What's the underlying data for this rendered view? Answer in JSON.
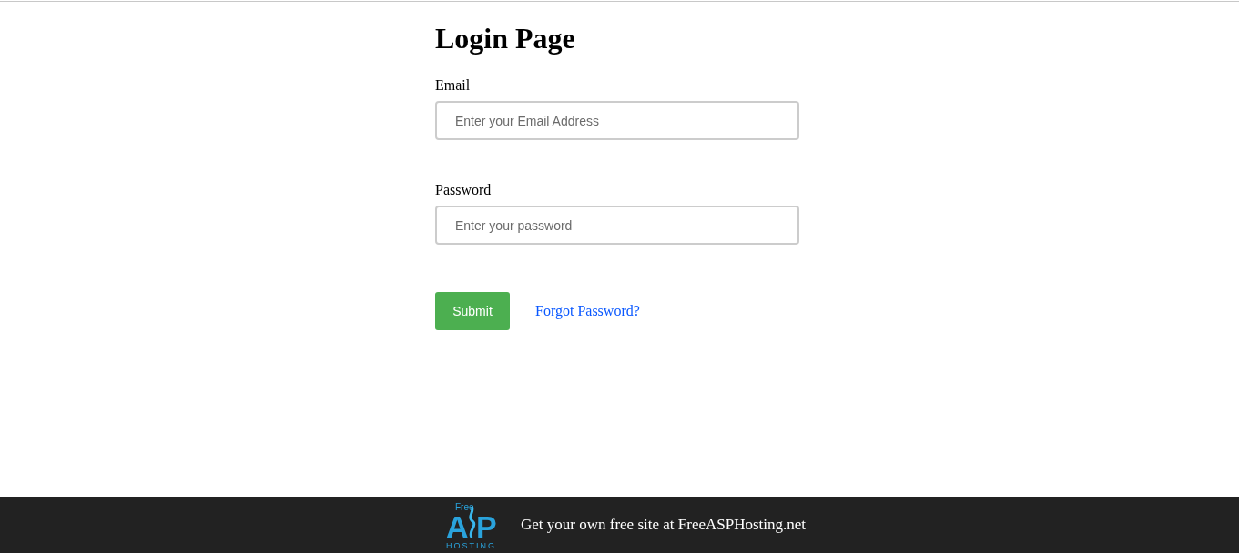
{
  "title": "Login Page",
  "fields": [
    {
      "label": "Email",
      "placeholder": "Enter your Email Address"
    },
    {
      "label": "Password",
      "placeholder": "Enter your password"
    }
  ],
  "submit_button": "Submit",
  "forgot_link": "Forgot Password?",
  "footer": {
    "logo": {
      "top": "Free",
      "left": "A",
      "right": "P",
      "bottom": "HOSTING"
    },
    "text": "Get your own free site at FreeASPHosting.net"
  }
}
